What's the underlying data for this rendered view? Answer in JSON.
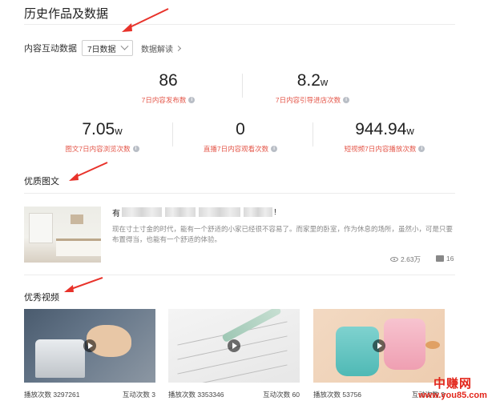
{
  "page": {
    "title": "历史作品及数据"
  },
  "filter": {
    "label": "内容互动数据",
    "select_value": "7日数据",
    "interpret_link": "数据解读"
  },
  "metrics": {
    "row1": [
      {
        "value": "86",
        "unit": "",
        "label": "7日内容发布数"
      },
      {
        "value": "8.2",
        "unit": "w",
        "label": "7日内容引导进店次数"
      }
    ],
    "row2": [
      {
        "value": "7.05",
        "unit": "w",
        "label": "图文7日内容浏览次数"
      },
      {
        "value": "0",
        "unit": "",
        "label": "直播7日内容观看次数"
      },
      {
        "value": "944.94",
        "unit": "w",
        "label": "短视频7日内容播放次数"
      }
    ],
    "info_glyph": "i"
  },
  "articles_section": {
    "title": "优质图文",
    "item": {
      "title_prefix": "有",
      "title_suffix": "!",
      "description": "现在寸土寸金的时代，能有一个舒适的小家已经很不容易了。而家里的卧室，作为休息的场所，虽然小，可是只要布置得当，也能有一个舒适的体验。",
      "views": "2.63万",
      "comments": "16"
    }
  },
  "videos_section": {
    "title": "优秀视频",
    "items": [
      {
        "plays_label": "播放次数",
        "plays": "3297261",
        "interact_label": "互动次数",
        "interact": "3"
      },
      {
        "plays_label": "播放次数",
        "plays": "3353346",
        "interact_label": "互动次数",
        "interact": "60"
      },
      {
        "plays_label": "播放次数",
        "plays": "53756",
        "interact_label": "互动次数",
        "interact": "3"
      }
    ]
  },
  "watermark": {
    "name": "中赚网",
    "url": "www.you85.com"
  },
  "colors": {
    "accent_red": "#e4574a",
    "annotation_red": "#e8322a",
    "watermark_red": "#e2261b"
  }
}
